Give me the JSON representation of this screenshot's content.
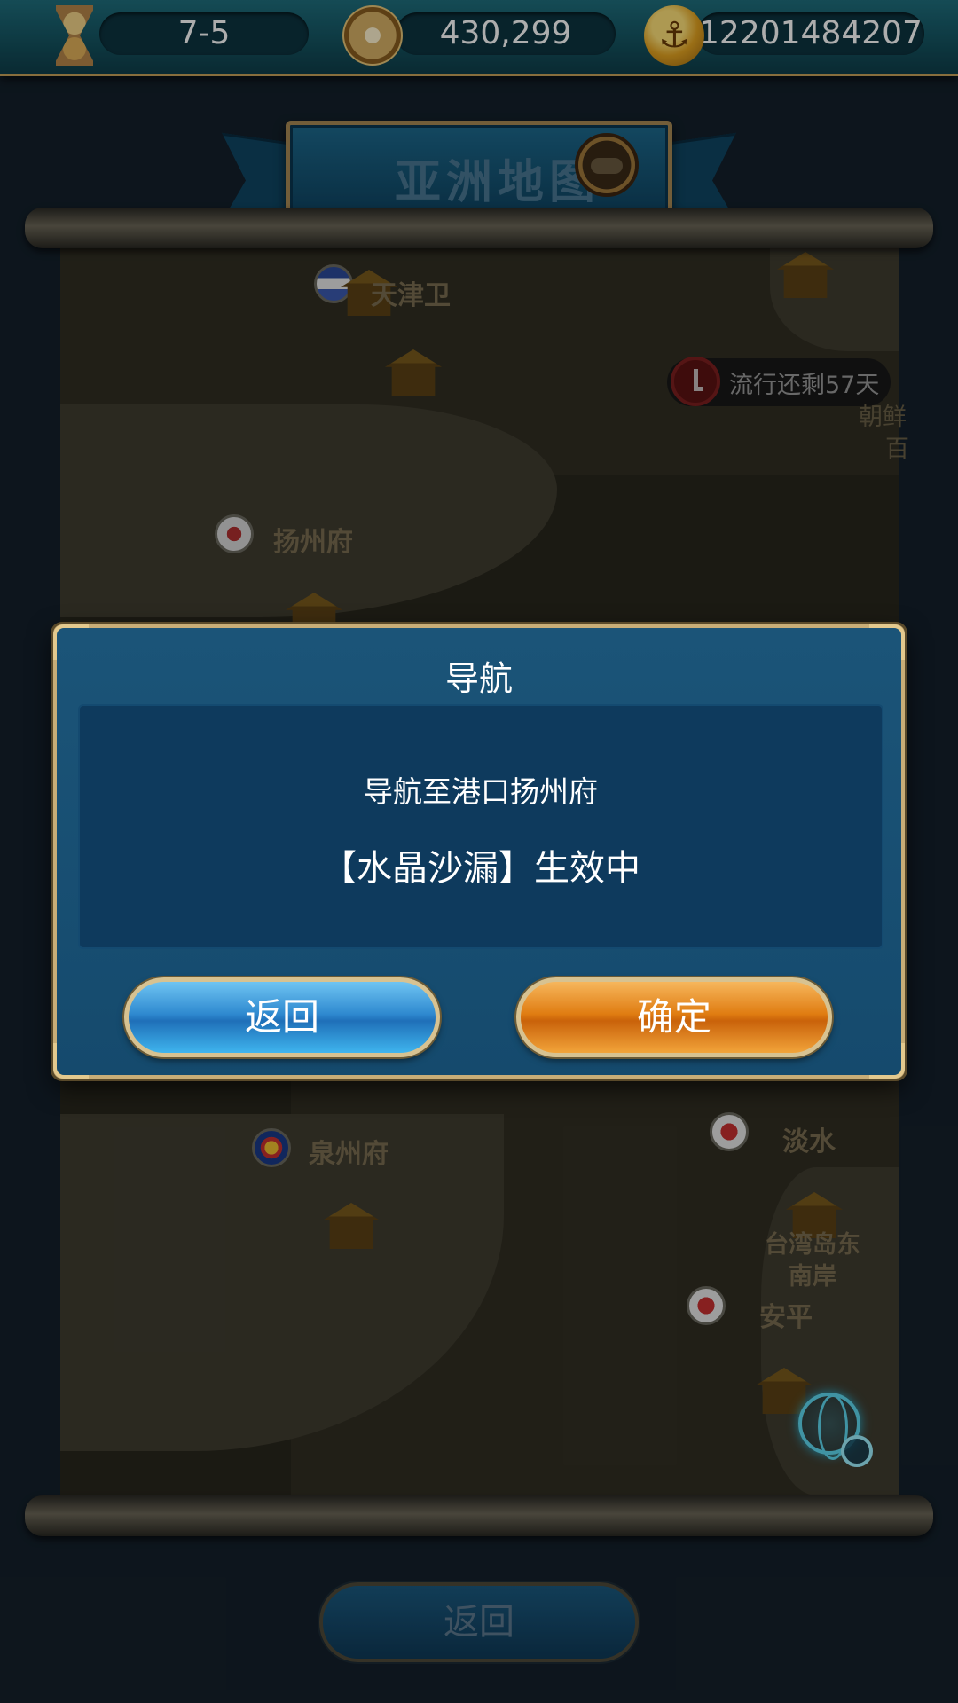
{
  "topbar": {
    "date": "7-5",
    "gold": "430,299",
    "coins": "12201484207",
    "icons": [
      "hourglass-icon",
      "compass-icon",
      "anchor-coin-icon"
    ]
  },
  "banner": {
    "title": "亚洲地图",
    "chat_icon": "chat-bubble-icon"
  },
  "map": {
    "ports": [
      {
        "name": "天津卫"
      },
      {
        "name": "扬州府"
      },
      {
        "name": "泉州府"
      },
      {
        "name": "淡水"
      },
      {
        "name": "台湾岛东南岸"
      },
      {
        "name": "安平"
      }
    ],
    "timer": "流行还剩57天",
    "edge_labels": [
      "朝鲜",
      "百"
    ],
    "globe_icon": "globe-search-icon"
  },
  "dialog": {
    "title": "导航",
    "line1": "导航至港口扬州府",
    "line2": "【水晶沙漏】生效中",
    "back_label": "返回",
    "confirm_label": "确定"
  },
  "footer": {
    "back_label": "返回"
  },
  "colors": {
    "topbar": "#1f6f7e",
    "dialog": "#1b5478",
    "confirm": "#e07d12",
    "back": "#2f8ad0",
    "gold_trim": "#c8ad77"
  }
}
